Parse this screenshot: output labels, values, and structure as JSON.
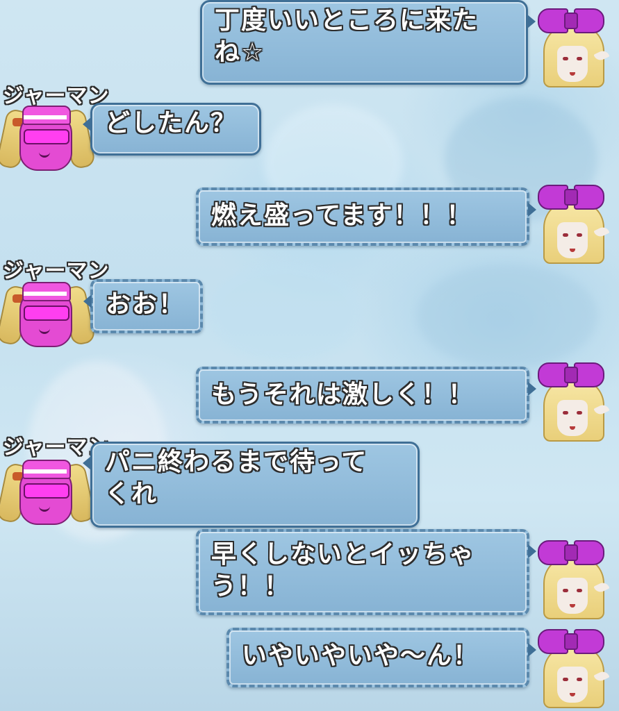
{
  "speaker_name": "ジャーマン",
  "messages": [
    {
      "side": "right",
      "text": "丁度いいところに来た\nね☆"
    },
    {
      "side": "left",
      "name": "ジャーマン",
      "text": "どしたん？"
    },
    {
      "side": "right",
      "text": "燃え盛ってます！！！"
    },
    {
      "side": "left",
      "name": "ジャーマン",
      "text": "おお！"
    },
    {
      "side": "right",
      "text": "もうそれは激しく！！"
    },
    {
      "side": "left",
      "name": "ジャーマン",
      "text": "パニ終わるまで待って\nくれ"
    },
    {
      "side": "right",
      "text": "早くしないとイッちゃ\nう！！"
    },
    {
      "side": "right",
      "text": "いやいやいや〜ん！"
    }
  ],
  "avatars": {
    "right": "blonde-elf-girl-purple-bow-icon",
    "left": "german-pink-visor-icon"
  },
  "colors": {
    "bubble": "#9ec6e2",
    "bubble_border": "#3f6f96",
    "text": "#ffffff",
    "outline": "#2d2d2d",
    "bow": "#c23ad6",
    "visor": "#e44bd3"
  }
}
